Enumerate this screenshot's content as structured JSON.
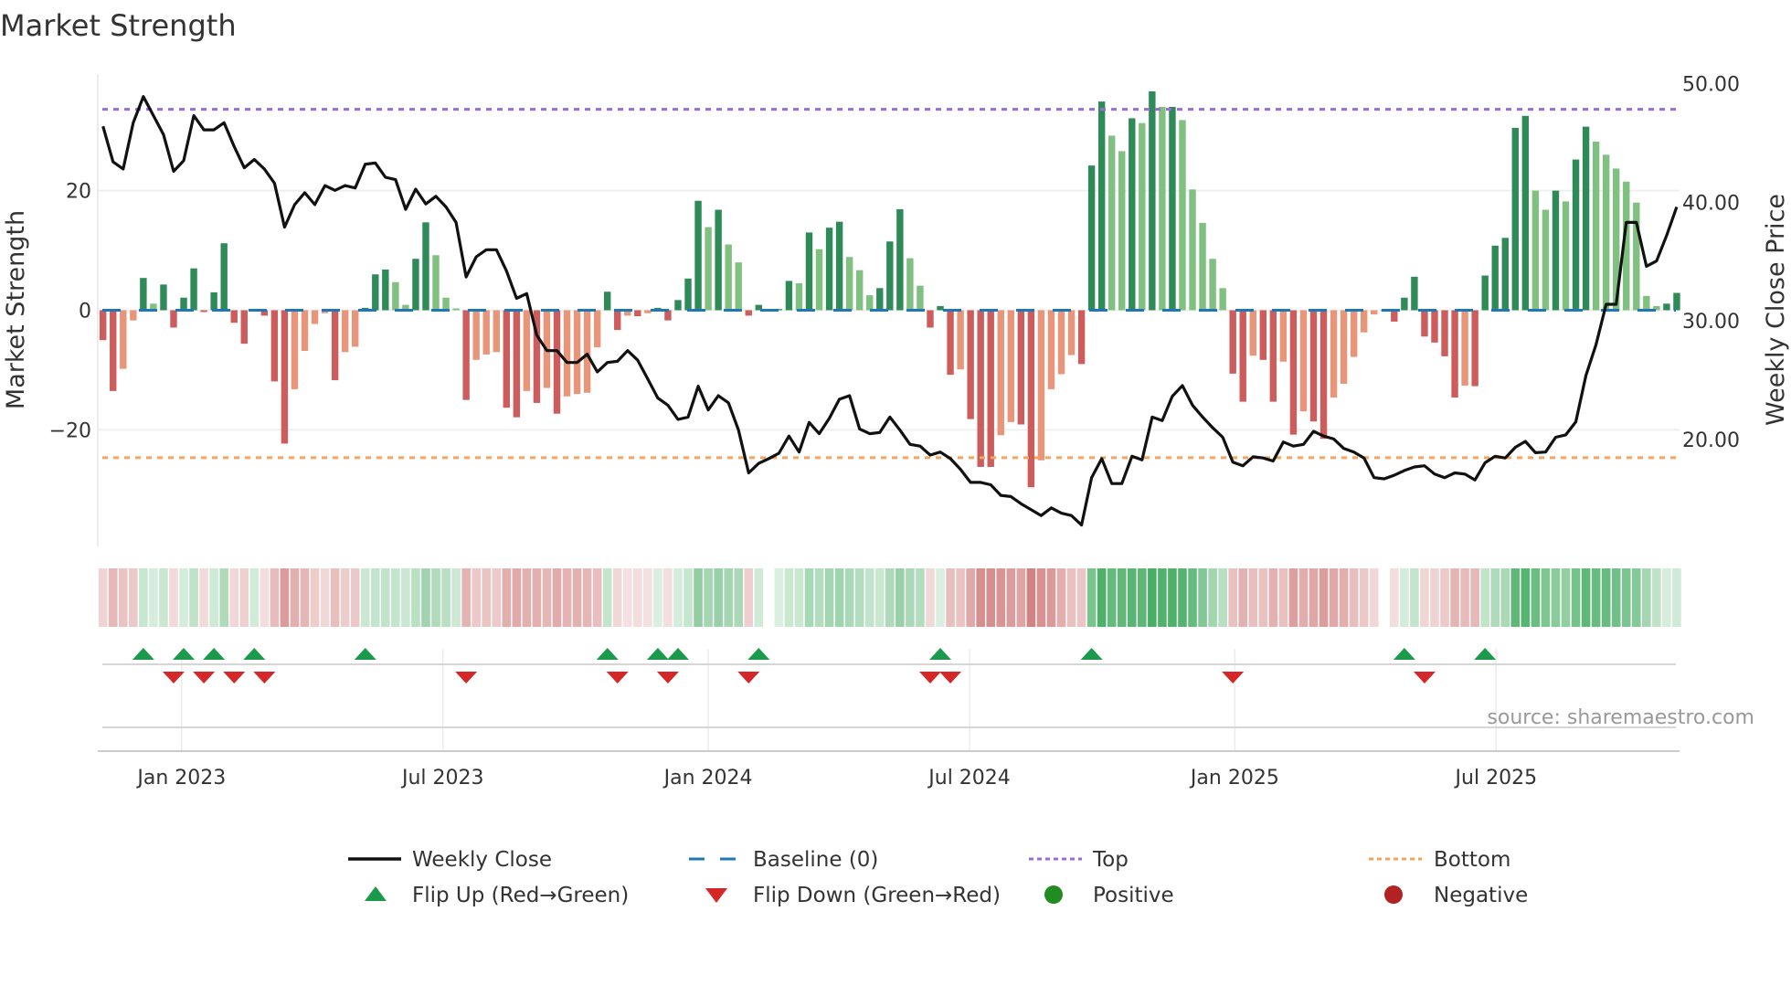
{
  "title": "Market Strength",
  "source": "source: sharemaestro.com",
  "colors": {
    "pos_rising": "#2e8b57",
    "pos_falling": "#80c080",
    "neg_falling": "#cd5c5c",
    "neg_rising": "#e8957a",
    "price_line": "#111111",
    "baseline": "#1f77b4",
    "top": "#9b6bd8",
    "bottom": "#f2a460",
    "flip_up": "#1a9a4a",
    "flip_down": "#d62728",
    "positive": "#228b22",
    "negative": "#b22222",
    "strip_green": "60,168,90",
    "strip_red": "200,100,100"
  },
  "chart_data": {
    "type": "bar",
    "title": "Market Strength",
    "ylabel": "Market Strength",
    "y2label": "Weekly Close Price",
    "ylim": [
      -39.5,
      39.5
    ],
    "y2lim": [
      11.0,
      50.8
    ],
    "grid": true,
    "yticks": [
      {
        "v": 20,
        "label": "20"
      },
      {
        "v": 0,
        "label": "0"
      },
      {
        "v": -20,
        "label": "−20"
      }
    ],
    "y2ticks": [
      {
        "v": 50,
        "label": "50.00"
      },
      {
        "v": 40,
        "label": "40.00"
      },
      {
        "v": 30,
        "label": "30.00"
      },
      {
        "v": 20,
        "label": "20.00"
      }
    ],
    "xticks": [
      {
        "x": 7.8,
        "label": "Jan 2023"
      },
      {
        "x": 33.7,
        "label": "Jul 2023"
      },
      {
        "x": 60.0,
        "label": "Jan 2024"
      },
      {
        "x": 85.9,
        "label": "Jul 2024"
      },
      {
        "x": 112.2,
        "label": "Jan 2025"
      },
      {
        "x": 138.1,
        "label": "Jul 2025"
      }
    ],
    "top_level": 33.6,
    "bottom_level": -24.65,
    "baseline": 0,
    "strength": [
      -5.0,
      -13.5,
      -9.8,
      -1.7,
      5.4,
      1.1,
      4.3,
      -2.9,
      2.1,
      7.0,
      -0.3,
      3.0,
      11.2,
      -2.1,
      -5.6,
      0.2,
      -0.9,
      -11.9,
      -22.3,
      -13.2,
      -6.8,
      -2.3,
      -0.5,
      -11.7,
      -7.0,
      -6.1,
      0.4,
      6.0,
      6.8,
      4.7,
      0.9,
      8.6,
      14.7,
      9.2,
      2.1,
      0.3,
      -15.0,
      -8.3,
      -7.4,
      -7.0,
      -16.3,
      -17.9,
      -13.5,
      -15.5,
      -13.0,
      -17.3,
      -14.4,
      -14.0,
      -13.8,
      -6.2,
      3.1,
      -3.3,
      -0.9,
      -1.0,
      -0.5,
      0.4,
      -1.7,
      1.7,
      5.3,
      18.3,
      13.9,
      16.8,
      11.0,
      8.0,
      -0.9,
      0.9,
      0,
      0.2,
      4.9,
      4.5,
      13.0,
      10.2,
      13.8,
      14.8,
      8.9,
      6.7,
      2.5,
      3.7,
      11.5,
      16.9,
      8.7,
      4.1,
      -2.9,
      0.7,
      -10.8,
      -9.9,
      -18.2,
      -26.2,
      -26.2,
      -20.9,
      -18.7,
      -19.1,
      -29.6,
      -25.1,
      -13.2,
      -10.7,
      -7.5,
      -9.0,
      24.2,
      34.9,
      29.2,
      26.6,
      32.1,
      31.3,
      36.6,
      34.0,
      34.0,
      31.8,
      20.2,
      14.6,
      8.6,
      3.7,
      -10.6,
      -15.3,
      -7.6,
      -8.3,
      -15.3,
      -8.6,
      -20.8,
      -16.9,
      -18.6,
      -21.5,
      -14.6,
      -12.3,
      -7.8,
      -3.7,
      -0.7,
      0,
      -1.9,
      2.1,
      5.6,
      -4.4,
      -5.4,
      -7.7,
      -14.6,
      -12.6,
      -12.7,
      5.8,
      10.8,
      12.1,
      30.5,
      32.5,
      20.0,
      16.8,
      20.0,
      18.2,
      25.2,
      30.7,
      28.2,
      26.0,
      23.7,
      21.5,
      18.0,
      2.4,
      0.7,
      1.1,
      2.9
    ],
    "weekly_close": [
      46.4,
      43.4,
      42.8,
      46.7,
      48.9,
      47.3,
      45.7,
      42.6,
      43.5,
      47.3,
      46.1,
      46.1,
      46.7,
      44.7,
      42.9,
      43.6,
      42.8,
      41.6,
      37.9,
      39.8,
      40.8,
      39.8,
      41.4,
      41.0,
      41.4,
      41.2,
      43.2,
      43.3,
      42.1,
      41.9,
      39.4,
      41.1,
      39.85,
      40.5,
      39.6,
      38.3,
      33.7,
      35.4,
      36.0,
      36.0,
      34.2,
      31.9,
      32.3,
      28.8,
      27.5,
      27.5,
      26.5,
      26.5,
      27.2,
      25.7,
      26.5,
      26.6,
      27.5,
      26.7,
      25.1,
      23.5,
      22.9,
      21.7,
      21.9,
      24.5,
      22.5,
      23.7,
      23.1,
      20.8,
      17.2,
      18.0,
      18.4,
      18.85,
      20.3,
      18.95,
      21.45,
      20.5,
      21.8,
      23.4,
      23.7,
      20.9,
      20.5,
      20.6,
      21.9,
      20.8,
      19.6,
      19.45,
      18.7,
      18.95,
      18.4,
      17.5,
      16.4,
      16.4,
      16.2,
      15.3,
      15.2,
      14.6,
      14.1,
      13.6,
      14.25,
      13.8,
      13.6,
      12.8,
      16.8,
      18.4,
      16.3,
      16.3,
      18.6,
      18.3,
      21.9,
      21.6,
      23.65,
      24.55,
      22.9,
      21.9,
      21.0,
      20.2,
      18.1,
      17.8,
      18.55,
      18.45,
      18.2,
      19.8,
      19.45,
      19.6,
      20.7,
      20.3,
      20.05,
      19.25,
      18.95,
      18.45,
      16.8,
      16.7,
      17.0,
      17.4,
      17.7,
      17.8,
      17.1,
      16.8,
      17.2,
      17.1,
      16.6,
      18.05,
      18.6,
      18.45,
      19.35,
      19.85,
      18.9,
      18.95,
      20.2,
      20.4,
      21.5,
      25.4,
      28.0,
      31.4,
      31.4,
      38.3,
      38.3,
      34.6,
      35.05,
      37.2,
      39.6
    ],
    "flip_up": [
      4,
      8,
      11,
      15,
      26,
      50,
      55,
      57,
      65,
      83,
      98,
      129,
      137
    ],
    "flip_down": [
      7,
      10,
      13,
      16,
      36,
      51,
      56,
      64,
      82,
      84,
      112,
      131
    ],
    "legend": {
      "placement": "bottom",
      "items": [
        {
          "key": "weekly-close",
          "label": "Weekly Close"
        },
        {
          "key": "baseline",
          "label": "Baseline (0)"
        },
        {
          "key": "top",
          "label": "Top"
        },
        {
          "key": "bottom",
          "label": "Bottom"
        },
        {
          "key": "flip-up",
          "label": "Flip Up (Red→Green)"
        },
        {
          "key": "flip-down",
          "label": "Flip Down (Green→Red)"
        },
        {
          "key": "positive",
          "label": "Positive"
        },
        {
          "key": "negative",
          "label": "Negative"
        }
      ]
    }
  }
}
